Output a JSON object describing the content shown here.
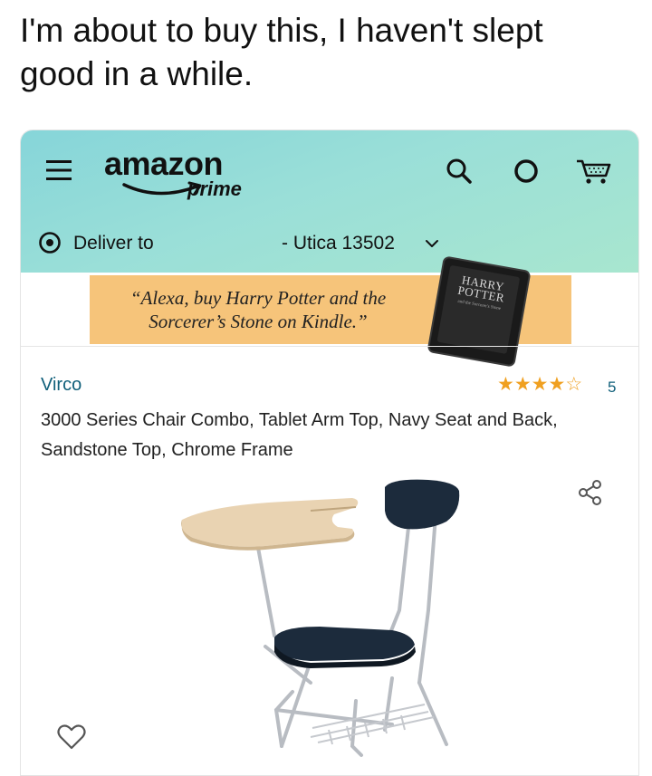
{
  "caption": "I'm about to buy this, I haven't slept good in a while.",
  "header": {
    "logo": "amazon",
    "logo_sub": "prime",
    "icons": [
      "menu-icon",
      "search-icon",
      "alexa-icon",
      "cart-icon"
    ]
  },
  "delivery": {
    "label": "Deliver to",
    "location": "- Utica 13502"
  },
  "banner": {
    "text": "“Alexa, buy Harry Potter and the Sorcerer’s Stone on Kindle.”",
    "device_title": "HARRY POTTER",
    "device_subtitle": "and the Sorcerer's Stone"
  },
  "product": {
    "brand": "Virco",
    "rating": 4.5,
    "review_count": "5",
    "title": "3000 Series Chair Combo, Tablet Arm Top, Navy Seat and Back, Sandstone Top, Chrome Frame"
  },
  "colors": {
    "header_gradient_start": "#86d5d9",
    "header_gradient_end": "#a8e6cf",
    "banner_bg": "#f6c47a",
    "link_teal": "#0f5f7a",
    "star_orange": "#f0a020",
    "seat_navy": "#1c2b3c",
    "desk_top_sandstone": "#e9d3b2"
  }
}
